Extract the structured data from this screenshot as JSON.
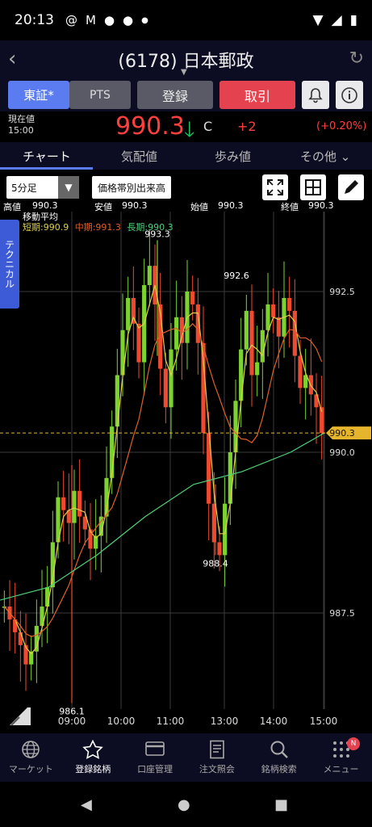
{
  "status_bar": {
    "time": "20:13",
    "icons": [
      "at-icon",
      "gmail-icon",
      "circle-icon",
      "circle-icon",
      "dot-icon"
    ]
  },
  "header": {
    "title": "(6178) 日本郵政"
  },
  "buttons": {
    "exchange": "東証*",
    "pts": "PTS",
    "register": "登録",
    "trade": "取引"
  },
  "quote": {
    "label": "現在値",
    "time": "15:00",
    "price": "990.3",
    "flag": "C",
    "change": "+2",
    "change_pct": "(+0.20%)"
  },
  "tabs": [
    {
      "label": "チャート"
    },
    {
      "label": "気配値"
    },
    {
      "label": "歩み値"
    },
    {
      "label": "その他"
    }
  ],
  "chart_controls": {
    "interval": "5分足",
    "volume_by_price": "価格帯別出来高"
  },
  "technical_tab": "テクニカル",
  "ohlc": {
    "high_label": "高値",
    "high": "990.3",
    "low_label": "安値",
    "low": "990.3",
    "open_label": "始値",
    "open": "990.3",
    "close_label": "終値",
    "close": "990.3"
  },
  "ma": {
    "title": "移動平均",
    "short": "短期:990.9",
    "mid": "中期:991.3",
    "long": "長期:990.3",
    "short_color": "#e0d04a",
    "mid_color": "#e0602a",
    "long_color": "#4cd27a"
  },
  "chart_data": {
    "type": "candlestick",
    "x_ticks": [
      "09:00",
      "10:00",
      "11:00",
      "13:00",
      "14:00",
      "15:00"
    ],
    "y_ticks": [
      "992.5",
      "990.0",
      "987.5"
    ],
    "current_price_label": "990.3",
    "annotations": [
      "993.3",
      "992.6",
      "988.4",
      "986.1"
    ],
    "ylim": [
      985.5,
      994.5
    ],
    "up_color": "#7cd330",
    "down_color": "#ef4a30"
  },
  "nav": [
    {
      "label": "マーケット",
      "icon": "globe-icon"
    },
    {
      "label": "登録銘柄",
      "icon": "star-icon"
    },
    {
      "label": "口座管理",
      "icon": "card-icon"
    },
    {
      "label": "注文照会",
      "icon": "document-icon"
    },
    {
      "label": "銘柄検索",
      "icon": "search-icon"
    },
    {
      "label": "メニュー",
      "icon": "grid-icon"
    }
  ],
  "nav_badge": "N"
}
